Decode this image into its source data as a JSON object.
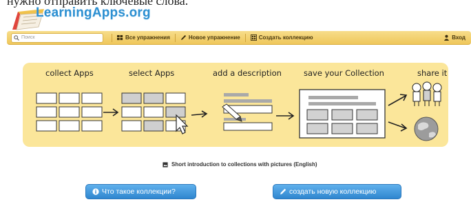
{
  "page": {
    "top_cut_text": "нужно отправить ключевые слова."
  },
  "header": {
    "logo_text": "LearningApps.org"
  },
  "navbar": {
    "search_placeholder": "Поиск",
    "all_exercises": "Все упражнения",
    "new_exercise": "Новое упражнение",
    "create_collection": "Создать коллекцию",
    "login": "Вход",
    "icons": [
      "search-icon",
      "grid-icon",
      "pencil-icon",
      "collection-icon",
      "user-icon"
    ]
  },
  "banner": {
    "steps": [
      "collect Apps",
      "select Apps",
      "add a description",
      "save your Collection",
      "share it"
    ],
    "background_color": "#fbe69a"
  },
  "intro": {
    "text": "Short introduction to collections with pictures (English)"
  },
  "buttons": {
    "what_are_collections": "Что такое коллекции?",
    "create_new_collection": "создать новую коллекцию"
  },
  "colors": {
    "accent_blue": "#2f86cf",
    "nav_yellow": "#efc75b",
    "logo_blue": "#2c8fd1"
  }
}
